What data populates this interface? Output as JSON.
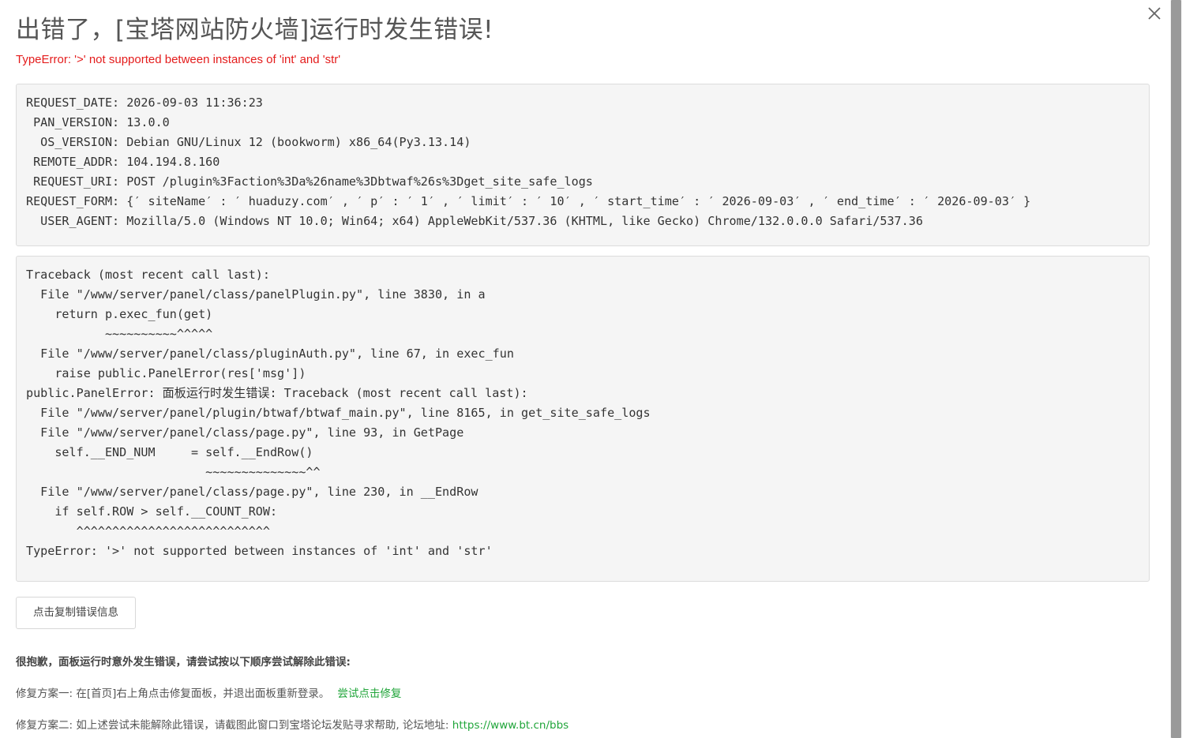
{
  "dialog": {
    "title": "出错了，[宝塔网站防火墙]运行时发生错误!",
    "error_message": "TypeError: '>' not supported between instances of 'int' and 'str'",
    "close_icon": "close-icon"
  },
  "request_info": [
    "REQUEST_DATE: 2026-09-03 11:36:23",
    " PAN_VERSION: 13.0.0",
    "  OS_VERSION: Debian GNU/Linux 12 (bookworm) x86_64(Py3.13.14)",
    " REMOTE_ADDR: 104.194.8.160",
    " REQUEST_URI: POST /plugin%3Faction%3Da%26name%3Dbtwaf%26s%3Dget_site_safe_logs",
    "REQUEST_FORM: {′ siteName′ : ′ huaduzy.com′ , ′ p′ : ′ 1′ , ′ limit′ : ′ 10′ , ′ start_time′ : ′ 2026-09-03′ , ′ end_time′ : ′ 2026-09-03′ }",
    "  USER_AGENT: Mozilla/5.0 (Windows NT 10.0; Win64; x64) AppleWebKit/537.36 (KHTML, like Gecko) Chrome/132.0.0.0 Safari/537.36"
  ],
  "traceback": [
    "Traceback (most recent call last):",
    "  File \"/www/server/panel/class/panelPlugin.py\", line 3830, in a",
    "    return p.exec_fun(get)",
    "           ~~~~~~~~~~^^^^^",
    "  File \"/www/server/panel/class/pluginAuth.py\", line 67, in exec_fun",
    "    raise public.PanelError(res['msg'])",
    "public.PanelError: 面板运行时发生错误: Traceback (most recent call last):",
    "  File \"/www/server/panel/plugin/btwaf/btwaf_main.py\", line 8165, in get_site_safe_logs",
    "  File \"/www/server/panel/class/page.py\", line 93, in GetPage",
    "    self.__END_NUM     = self.__EndRow()",
    "                         ~~~~~~~~~~~~~~^^",
    "  File \"/www/server/panel/class/page.py\", line 230, in __EndRow",
    "    if self.ROW > self.__COUNT_ROW:",
    "       ^^^^^^^^^^^^^^^^^^^^^^^^^^^",
    "TypeError: '>' not supported between instances of 'int' and 'str'"
  ],
  "copy_button": {
    "label": "点击复制错误信息"
  },
  "help": {
    "title": "很抱歉，面板运行时意外发生错误，请尝试按以下顺序尝试解除此错误:",
    "fix1_text": "修复方案一: 在[首页]右上角点击修复面板，并退出面板重新登录。",
    "fix1_link": "尝试点击修复",
    "fix2_text": "修复方案二: 如上述尝试未能解除此错误，请截图此窗口到宝塔论坛发贴寻求帮助, 论坛地址: ",
    "fix2_link": "https://www.bt.cn/bbs"
  },
  "colors": {
    "error_red": "#e41c1c",
    "link_green": "#20a53a",
    "code_bg": "#f5f5f5"
  }
}
